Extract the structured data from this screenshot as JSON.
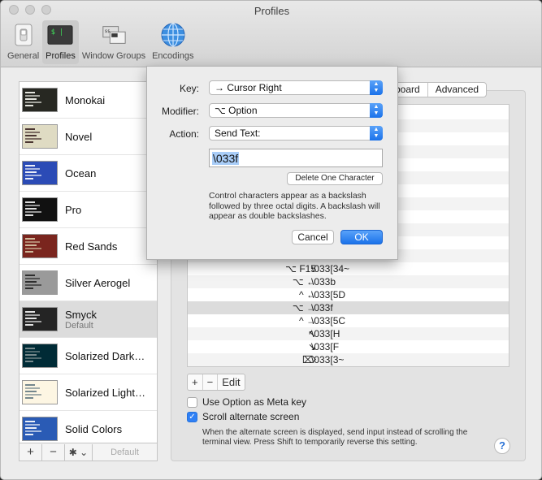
{
  "window": {
    "title": "Profiles"
  },
  "toolbar": {
    "items": [
      {
        "label": "General",
        "icon": "general-switch-icon",
        "active": false
      },
      {
        "label": "Profiles",
        "icon": "terminal-icon",
        "active": true
      },
      {
        "label": "Window Groups",
        "icon": "window-groups-icon",
        "active": false
      },
      {
        "label": "Encodings",
        "icon": "globe-icon",
        "active": false
      }
    ]
  },
  "profiles": {
    "items": [
      {
        "name": "Monokai",
        "sub": "",
        "bg": "#272822",
        "fg": "#f8f8f2"
      },
      {
        "name": "Novel",
        "sub": "",
        "bg": "#dfdbc3",
        "fg": "#3b2322"
      },
      {
        "name": "Ocean",
        "sub": "",
        "bg": "#2b4bb6",
        "fg": "#ffffff"
      },
      {
        "name": "Pro",
        "sub": "",
        "bg": "#111111",
        "fg": "#f2f2f2"
      },
      {
        "name": "Red Sands",
        "sub": "",
        "bg": "#7a251e",
        "fg": "#d7c9a7"
      },
      {
        "name": "Silver Aerogel",
        "sub": "",
        "bg": "#9a9a9a",
        "fg": "#222222"
      },
      {
        "name": "Smyck",
        "sub": "Default",
        "bg": "#242424",
        "fg": "#f7f7f7"
      },
      {
        "name": "Solarized Dark…",
        "sub": "",
        "bg": "#002b36",
        "fg": "#839496"
      },
      {
        "name": "Solarized Light…",
        "sub": "",
        "bg": "#fdf6e3",
        "fg": "#657b83"
      },
      {
        "name": "Solid Colors",
        "sub": "",
        "bg": "#2a5bb5",
        "fg": "#ffffff"
      }
    ],
    "add_label": "+",
    "remove_label": "−",
    "gear_label": "✱ ⌄",
    "default_label": "Default"
  },
  "tabs": [
    "board",
    "Advanced"
  ],
  "keyboard_table": {
    "rows": [
      {
        "key": "⌥ F15",
        "action": "\\033[34~"
      },
      {
        "key": "⌥ ←",
        "action": "\\033b"
      },
      {
        "key": "^ ←",
        "action": "\\033[5D"
      },
      {
        "key": "⌥ →",
        "action": "\\033f"
      },
      {
        "key": "^ →",
        "action": "\\033[5C"
      },
      {
        "key": "↖",
        "action": "\\033[H"
      },
      {
        "key": "↘",
        "action": "\\033[F"
      },
      {
        "key": "⌦",
        "action": "\\033[3~"
      }
    ],
    "add_label": "+",
    "remove_label": "−",
    "edit_label": "Edit"
  },
  "options": {
    "meta_key_label": "Use Option as Meta key",
    "meta_key_checked": false,
    "scroll_alt_label": "Scroll alternate screen",
    "scroll_alt_checked": true,
    "note": "When the alternate screen is displayed, send input instead of scrolling the terminal view. Press Shift to temporarily reverse this setting.",
    "help_label": "?"
  },
  "sheet": {
    "key_label": "Key:",
    "key_value": "→ Cursor Right",
    "modifier_label": "Modifier:",
    "modifier_value": "⌥ Option",
    "action_label": "Action:",
    "action_value": "Send Text:",
    "text_value": "\\033f",
    "delete_label": "Delete One Character",
    "help_text": "Control characters appear as a backslash followed by three octal digits. A backslash will appear as double backslashes.",
    "cancel_label": "Cancel",
    "ok_label": "OK"
  }
}
